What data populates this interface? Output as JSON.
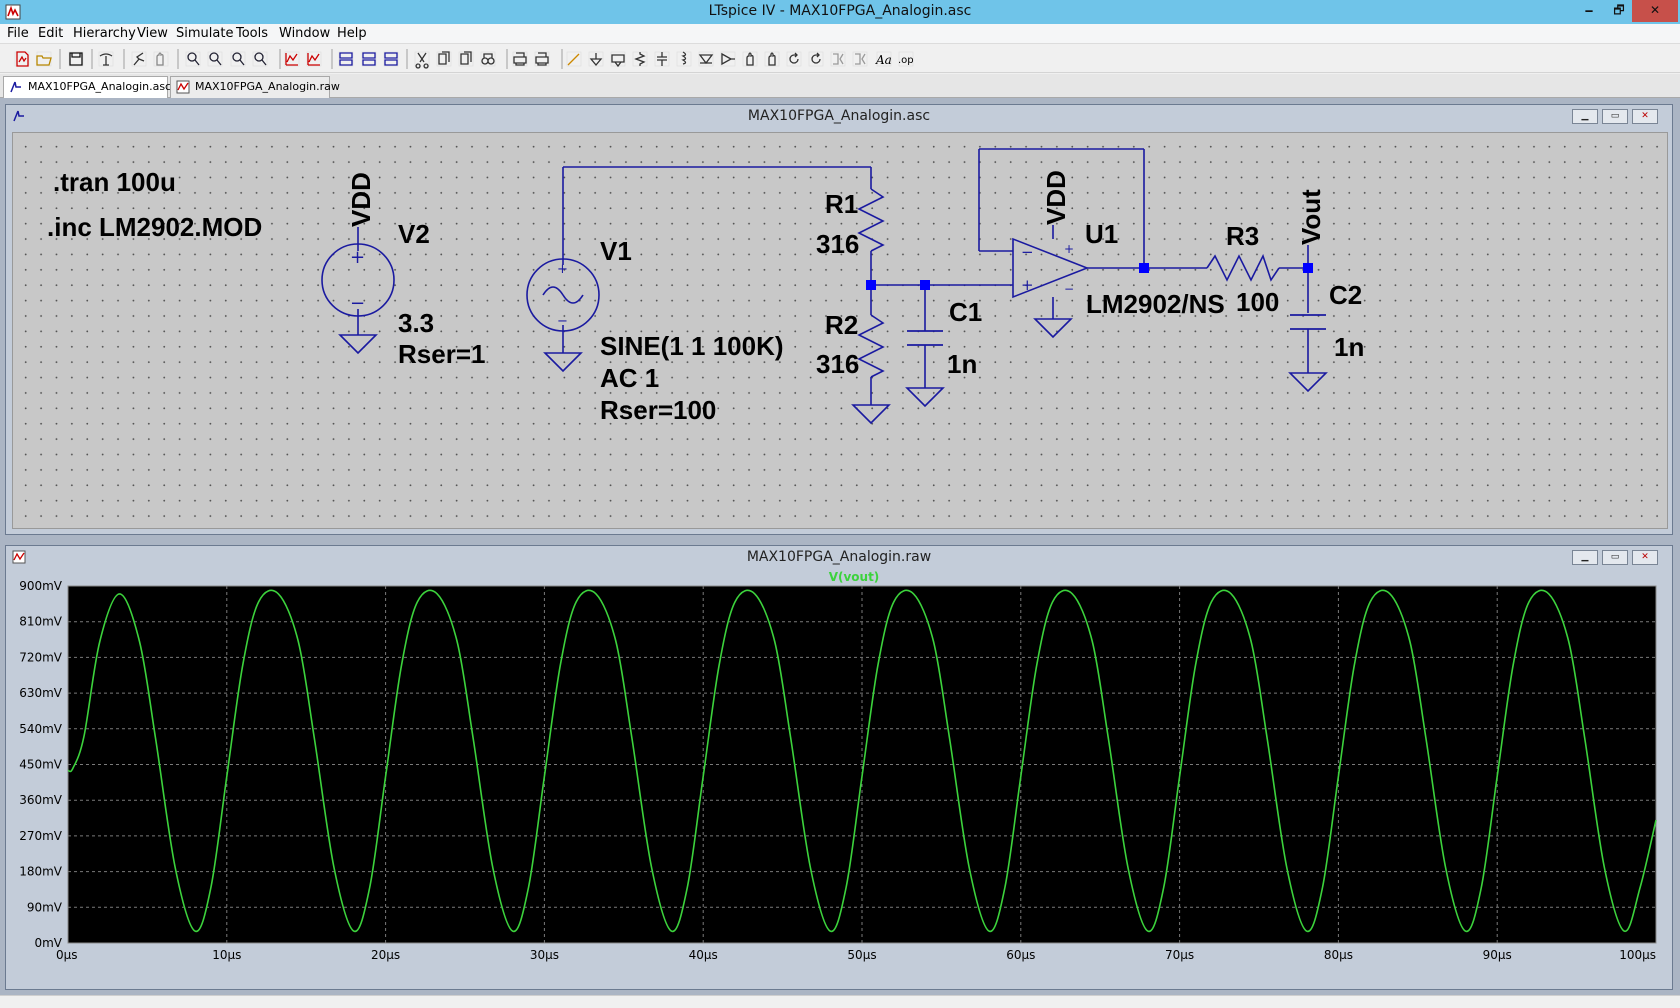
{
  "window": {
    "title": "LTspice IV - MAX10FPGA_Analogin.asc",
    "minimize_glyph": "🗕",
    "maximize_glyph": "🗗",
    "close_glyph": "✕"
  },
  "menu": {
    "items": [
      {
        "label": "File"
      },
      {
        "label": "Edit"
      },
      {
        "label": "Hierarchy"
      },
      {
        "label": "View"
      },
      {
        "label": "Simulate"
      },
      {
        "label": "Tools"
      },
      {
        "label": "Window"
      },
      {
        "label": "Help"
      }
    ]
  },
  "toolbar": {
    "icons": [
      "new-schematic-icon",
      "open-icon",
      "save-icon",
      "control-panel-icon",
      "run-icon",
      "halt-icon",
      "zoom-in-icon",
      "zoom-pan-icon",
      "zoom-out-icon",
      "zoom-fit-icon",
      "autorange-icon",
      "visible-traces-icon",
      "tile-horizontal-icon",
      "cascade-icon",
      "tile-vertical-icon",
      "cut-icon",
      "copy-icon",
      "paste-icon",
      "find-icon",
      "print-setup-icon",
      "print-icon",
      "wire-icon",
      "ground-icon",
      "label-net-icon",
      "resistor-icon",
      "capacitor-icon",
      "inductor-icon",
      "diode-icon",
      "component-icon",
      "move-icon",
      "drag-icon",
      "undo-icon",
      "redo-icon",
      "rotate-icon",
      "mirror-icon",
      "text-icon",
      "spice-directive-icon"
    ],
    "text_icon_label": "Aa",
    "directive_icon_label": ".op"
  },
  "tabs": [
    {
      "label": "MAX10FPGA_Analogin.asc",
      "active": true
    },
    {
      "label": "MAX10FPGA_Analogin.raw",
      "active": false
    }
  ],
  "schematic": {
    "title": "MAX10FPGA_Analogin.asc",
    "directives": [
      ".tran 100u",
      ".inc LM2902.MOD"
    ],
    "v2": {
      "name": "V2",
      "value": "3.3",
      "param": "Rser=1",
      "net": "VDD"
    },
    "v1": {
      "name": "V1",
      "value": "SINE(1 1 100K)",
      "ac": "AC 1",
      "param": "Rser=100"
    },
    "r1": {
      "name": "R1",
      "value": "316"
    },
    "r2": {
      "name": "R2",
      "value": "316"
    },
    "c1": {
      "name": "C1",
      "value": "1n"
    },
    "u1": {
      "name": "U1",
      "model": "LM2902/NS",
      "net": "VDD"
    },
    "r3": {
      "name": "R3",
      "value": "100"
    },
    "c2": {
      "name": "C2",
      "value": "1n"
    },
    "out_net": "Vout",
    "plus": "+",
    "minus": "−"
  },
  "waveform": {
    "title": "MAX10FPGA_Analogin.raw"
  },
  "colors": {
    "titlebar": "#6fc4e9",
    "wire": "#1a1aa0",
    "junction": "#0000ff",
    "trace": "#3cd23c",
    "plot_bg": "#000000"
  },
  "chart_data": {
    "type": "line",
    "title": "V(vout)",
    "xlabel": "",
    "ylabel": "",
    "x_ticks": [
      "0µs",
      "10µs",
      "20µs",
      "30µs",
      "40µs",
      "50µs",
      "60µs",
      "70µs",
      "80µs",
      "90µs",
      "100µs"
    ],
    "y_ticks": [
      "0mV",
      "90mV",
      "180mV",
      "270mV",
      "360mV",
      "450mV",
      "540mV",
      "630mV",
      "720mV",
      "810mV",
      "900mV"
    ],
    "xlim": [
      0,
      100
    ],
    "ylim": [
      0,
      900
    ],
    "grid": true,
    "series": [
      {
        "name": "V(vout)",
        "x": [
          0,
          0.3,
          1.0,
          2.0,
          3.25,
          4.5,
          5.5,
          6.75,
          8.0,
          9.0,
          10.0,
          11.0,
          12.0,
          13.25,
          14.5,
          15.5,
          16.75,
          18.0,
          19.0,
          20.0,
          21.0,
          22.0,
          23.25,
          24.5,
          25.5,
          26.75,
          28.0,
          29.0,
          30.0,
          31.0,
          32.0,
          33.25,
          34.5,
          35.5,
          36.75,
          38.0,
          39.0,
          40.0,
          41.0,
          42.0,
          43.25,
          44.5,
          45.5,
          46.75,
          48.0,
          49.0,
          50.0,
          51.0,
          52.0,
          53.25,
          54.5,
          55.5,
          56.75,
          58.0,
          59.0,
          60.0,
          61.0,
          62.0,
          63.25,
          64.5,
          65.5,
          66.75,
          68.0,
          69.0,
          70.0,
          71.0,
          72.0,
          73.25,
          74.5,
          75.5,
          76.75,
          78.0,
          79.0,
          80.0,
          81.0,
          82.0,
          83.25,
          84.5,
          85.5,
          86.75,
          88.0,
          89.0,
          90.0,
          91.0,
          92.0,
          93.25,
          94.5,
          95.5,
          96.75,
          98.0,
          99.0,
          100.0
        ],
        "y": [
          435,
          440,
          520,
          760,
          880,
          760,
          520,
          190,
          30,
          140,
          420,
          700,
          860,
          880,
          760,
          520,
          190,
          30,
          140,
          420,
          700,
          860,
          880,
          760,
          520,
          190,
          30,
          140,
          420,
          700,
          860,
          880,
          760,
          520,
          190,
          30,
          140,
          420,
          700,
          860,
          880,
          760,
          520,
          190,
          30,
          140,
          420,
          700,
          860,
          880,
          760,
          520,
          190,
          30,
          140,
          420,
          700,
          860,
          880,
          760,
          520,
          190,
          30,
          140,
          420,
          700,
          860,
          880,
          760,
          520,
          190,
          30,
          140,
          420,
          700,
          860,
          880,
          760,
          520,
          190,
          30,
          140,
          420,
          700,
          860,
          880,
          760,
          520,
          190,
          30,
          140,
          310
        ]
      }
    ]
  }
}
